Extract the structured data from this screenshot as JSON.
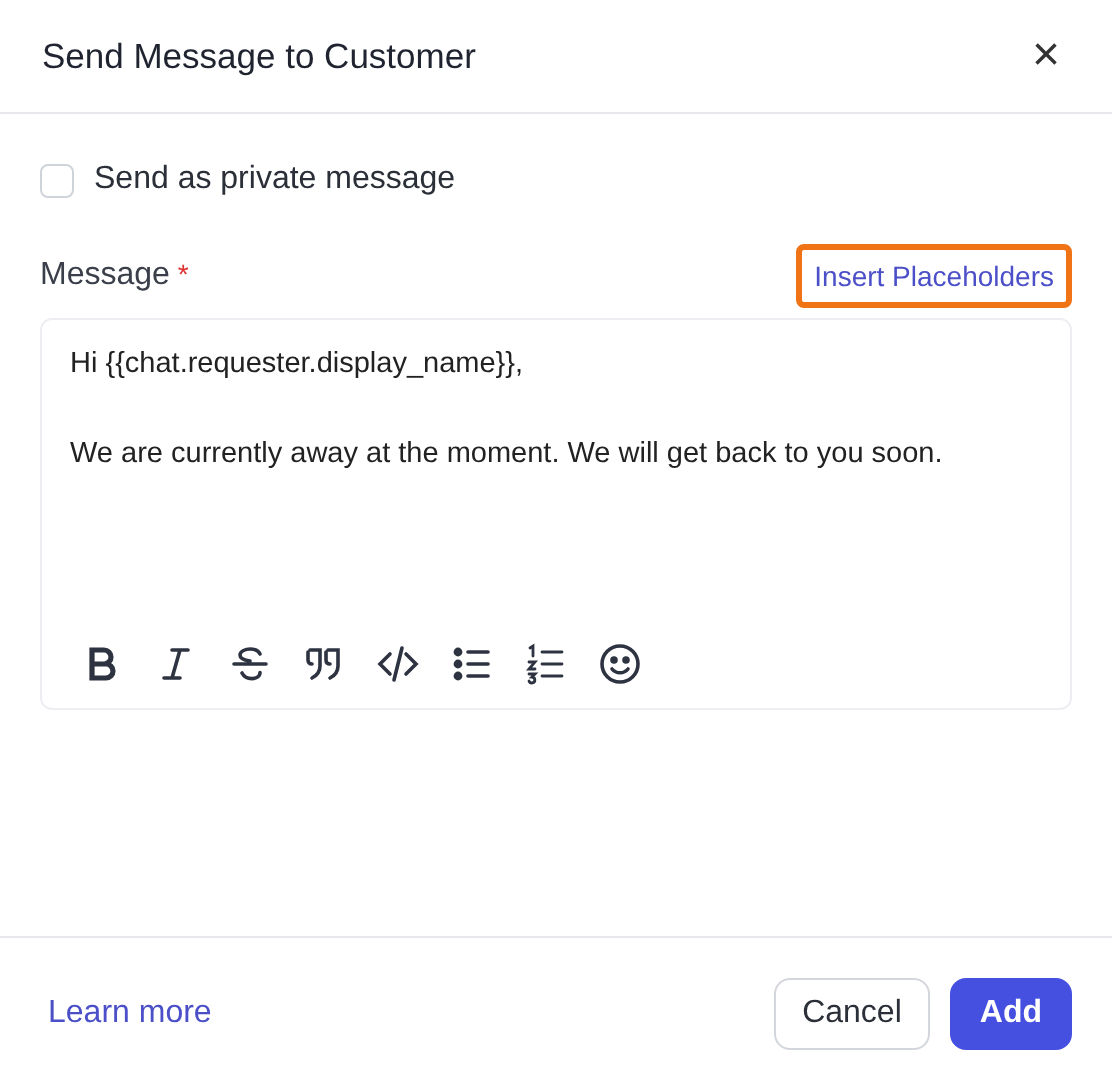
{
  "dialog": {
    "title": "Send Message to Customer",
    "close": "×"
  },
  "private_option": {
    "label": "Send as private message",
    "checked": false
  },
  "message": {
    "label": "Message",
    "required_mark": "*",
    "insert_link": {
      "label": "Insert Placeholders",
      "highlighted": true
    },
    "paragraphs": [
      "Hi {{chat.requester.display_name}},",
      "We are currently away at the moment. We will get back to you soon."
    ]
  },
  "footer": {
    "link": "Learn more",
    "buttons": [
      {
        "label": "Cancel",
        "kind": "secondary"
      },
      {
        "label": "Add",
        "kind": "primary"
      }
    ]
  }
}
